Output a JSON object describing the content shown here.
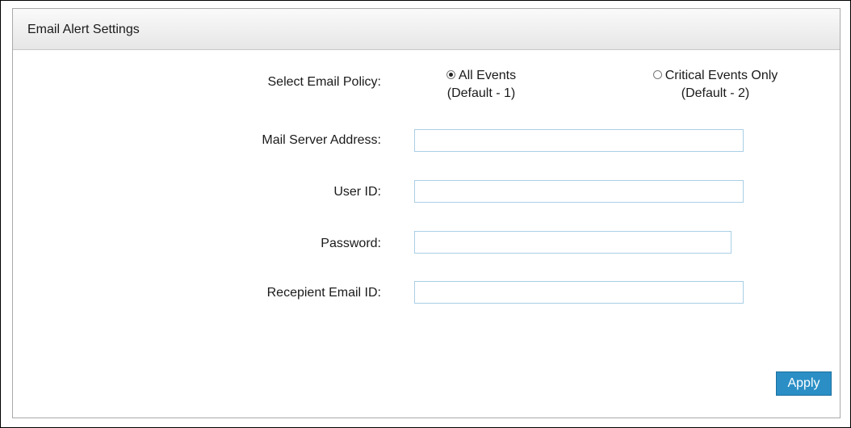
{
  "panel": {
    "title": "Email Alert Settings"
  },
  "form": {
    "policy_label": "Select Email Policy:",
    "policy_options": [
      {
        "label": "All Events",
        "sublabel": "(Default - 1)",
        "selected": true
      },
      {
        "label": "Critical Events Only",
        "sublabel": "(Default - 2)",
        "selected": false
      }
    ],
    "mail_server_label": "Mail Server Address:",
    "mail_server_value": "",
    "user_id_label": "User ID:",
    "user_id_value": "",
    "password_label": "Password:",
    "password_value": "",
    "recipient_label": "Recepient Email ID:",
    "recipient_value": ""
  },
  "actions": {
    "apply_label": "Apply"
  },
  "colors": {
    "accent": "#2b8fc6",
    "input_border": "#a9cfe6"
  }
}
